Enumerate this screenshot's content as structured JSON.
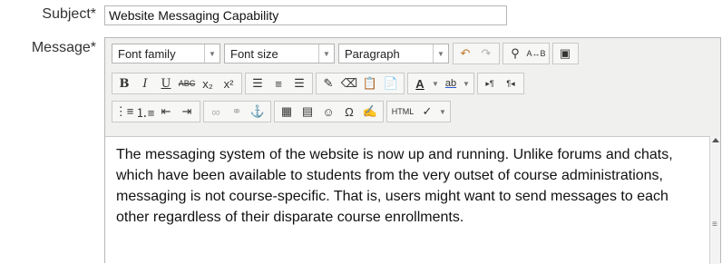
{
  "form": {
    "subject_label": "Subject*",
    "subject_value": "Website Messaging Capability",
    "message_label": "Message*"
  },
  "toolbar": {
    "font_family": "Font family",
    "font_size": "Font size",
    "paragraph": "Paragraph",
    "bold": "B",
    "italic": "I",
    "underline": "U",
    "strike": "ABC",
    "subscript": "x₂",
    "superscript": "x²",
    "html_label": "HTML"
  },
  "content": {
    "text": "The messaging system of the website is now up and running. Unlike forums and chats, which have been available to students from the very outset of course administrations, messaging is not course-specific. That is, users might want to send messages to each other regardless of their disparate course enrollments."
  },
  "icons": [
    "undo-icon",
    "redo-icon",
    "find-icon",
    "replace-icon",
    "fullscreen-icon",
    "align-left-icon",
    "align-center-icon",
    "align-right-icon",
    "cleanup-icon",
    "eraser-icon",
    "paste-text-icon",
    "paste-word-icon",
    "font-color-icon",
    "highlight-icon",
    "ltr-icon",
    "rtl-icon",
    "bullet-list-icon",
    "numbered-list-icon",
    "outdent-icon",
    "indent-icon",
    "link-icon",
    "unlink-icon",
    "anchor-icon",
    "image-icon",
    "media-icon",
    "emoticon-icon",
    "special-char-icon",
    "edit-icon",
    "spellcheck-icon"
  ]
}
